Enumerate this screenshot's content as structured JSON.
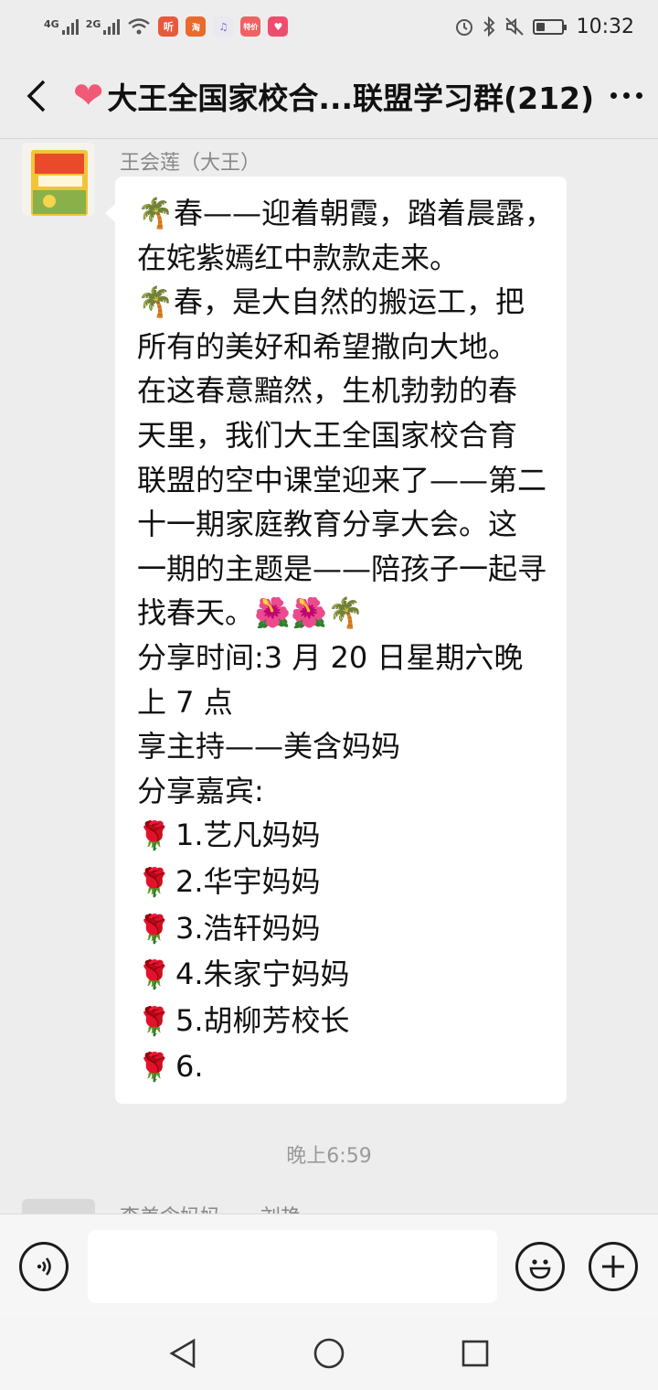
{
  "status_bar": {
    "network1": "4G",
    "network2": "2G",
    "app_icons": [
      "听",
      "淘",
      "♫",
      "特价",
      "♥"
    ],
    "time": "10:32",
    "battery_level": 0.3
  },
  "header": {
    "title": "大王全国家校合...联盟学习群(212)",
    "icons": [
      "back-icon",
      "heart-emoji",
      "more-icon"
    ]
  },
  "messages": [
    {
      "sender": "王会莲（大王）",
      "lines": [
        "春——迎着朝霞，踏着晨露，",
        "在姹紫嫣红中款款走来。",
        "春，是大自然的搬运工，把",
        "所有的美好和希望撒向大地。",
        "在这春意黯然，生机勃勃的春",
        "天里，我们大王全国家校合育",
        "联盟的空中课堂迎来了——第二",
        "十一期家庭教育分享大会。这",
        "一期的主题是——陪孩子一起寻",
        "找春天。",
        " 分享时间:3 月 20 日星期六晚",
        "上 7 点",
        "享主持——美含妈妈",
        "分享嘉宾:",
        "1.艺凡妈妈",
        "2.华宇妈妈",
        "3.浩轩妈妈",
        "4.朱家宁妈妈",
        "5.胡柳芳校长",
        "6."
      ]
    }
  ],
  "timestamp": "晚上6:59",
  "next_message": {
    "sender": "李美含妈妈——刘艳"
  },
  "input": {
    "value": "",
    "placeholder": ""
  },
  "emoji": {
    "palm": "🌴",
    "hibiscus": "🌺",
    "rose": "🌹"
  },
  "colors": {
    "bubble": "#ffffff",
    "background": "#ededed",
    "heart": "#f05a76",
    "rose": "#d8243a"
  }
}
